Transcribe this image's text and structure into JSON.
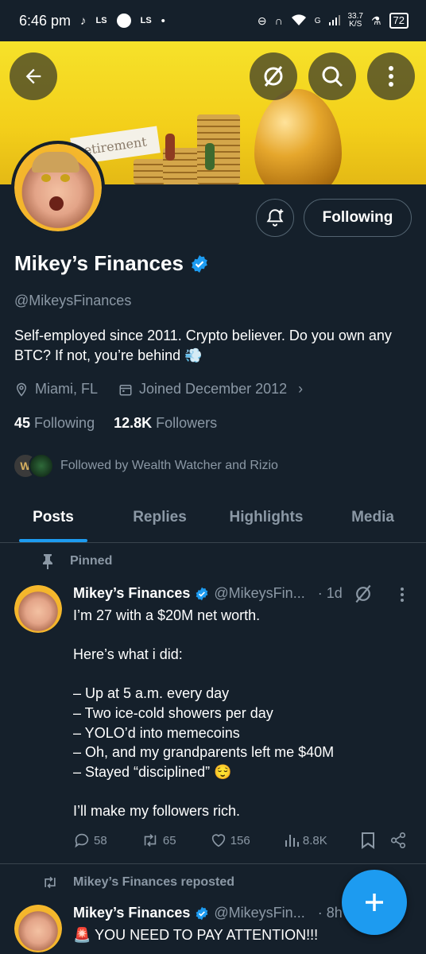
{
  "status_bar": {
    "time": "6:46 pm",
    "app1": "LS",
    "app2": "LS",
    "network": "G",
    "speed": "33.7",
    "speed_unit": "K/S",
    "battery": "72"
  },
  "banner": {
    "card_text": "etirement"
  },
  "profile": {
    "follow_label": "Following",
    "name": "Mikey’s Finances",
    "handle": "@MikeysFinances",
    "bio": "Self-employed since 2011. Crypto believer. Do you own any BTC? If not, you’re behind 💨",
    "location": "Miami, FL",
    "joined": "Joined December 2012",
    "following_count": "45",
    "following_label": "Following",
    "followers_count": "12.8K",
    "followers_label": "Followers",
    "followed_by": "Followed by Wealth Watcher and Rizio"
  },
  "tabs": [
    {
      "label": "Posts",
      "active": true
    },
    {
      "label": "Replies",
      "active": false
    },
    {
      "label": "Highlights",
      "active": false
    },
    {
      "label": "Media",
      "active": false
    }
  ],
  "pinned_tweet": {
    "context": "Pinned",
    "name": "Mikey’s Finances",
    "handle": "@MikeysFin...",
    "time": "· 1d",
    "body": "I’m 27 with a $20M net worth.\n\nHere’s what i did:\n\n– Up at 5 a.m. every day\n– Two ice-cold showers per day\n– YOLO’d into memecoins\n– Oh, and my grandparents left me $40M\n– Stayed “disciplined” 😌\n\nI’ll make my followers rich.",
    "replies": "58",
    "reposts": "65",
    "likes": "156",
    "views": "8.8K"
  },
  "second_tweet": {
    "context": "Mikey’s Finances reposted",
    "name": "Mikey’s Finances",
    "handle": "@MikeysFin...",
    "time": "· 8h",
    "body": "🚨 YOU NEED TO PAY ATTENTION!!!"
  },
  "colors": {
    "background": "#15202b",
    "accent": "#1d9bf0",
    "muted": "#8b98a5",
    "banner": "#f3cf1a"
  }
}
